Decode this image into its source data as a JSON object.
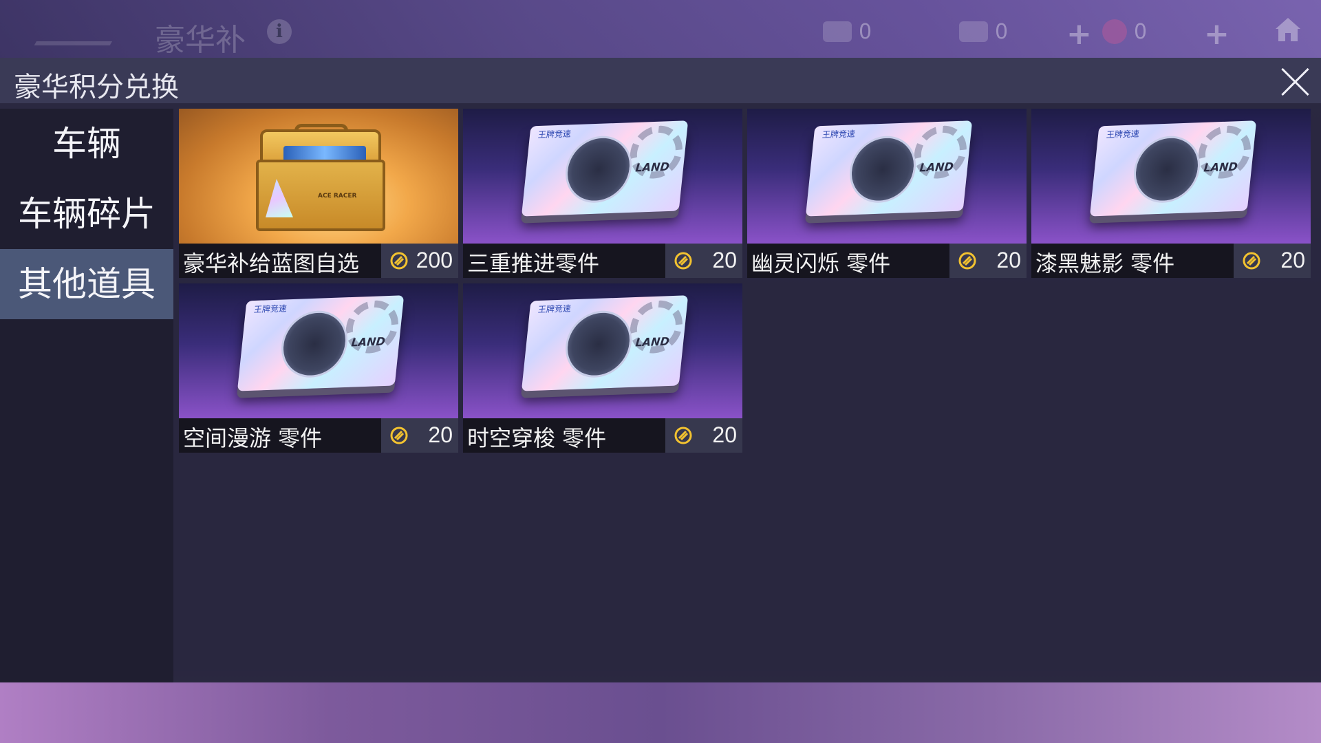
{
  "background": {
    "title": "豪华补",
    "resources": [
      {
        "icon": "ticket-icon",
        "count": "0"
      },
      {
        "icon": "coupon-icon",
        "count": "0"
      },
      {
        "icon": "star-medal-icon",
        "count": "0"
      }
    ]
  },
  "dialog": {
    "title": "豪华积分兑换",
    "close_icon": "close-icon"
  },
  "sidebar": {
    "items": [
      {
        "label": "车辆",
        "active": false
      },
      {
        "label": "车辆碎片",
        "active": false
      },
      {
        "label": "其他道具",
        "active": true
      }
    ]
  },
  "items": [
    {
      "name": "豪华补给蓝图自选",
      "price": "200",
      "art": "gold-chest"
    },
    {
      "name": "三重推进零件",
      "price": "20",
      "art": "parts-box"
    },
    {
      "name": "幽灵闪烁 零件",
      "price": "20",
      "art": "parts-box"
    },
    {
      "name": "漆黑魅影 零件",
      "price": "20",
      "art": "parts-box"
    },
    {
      "name": "空间漫游 零件",
      "price": "20",
      "art": "parts-box"
    },
    {
      "name": "时空穿梭 零件",
      "price": "20",
      "art": "parts-box"
    }
  ],
  "colors": {
    "active_tab": "#4b5878",
    "sidebar_bg": "#1f1e30",
    "price_bg": "#37384e",
    "coin": "#f2c230"
  },
  "box_text": {
    "brand": "王牌竞速",
    "land": "LAND",
    "chest_label": "ACE RACER"
  }
}
